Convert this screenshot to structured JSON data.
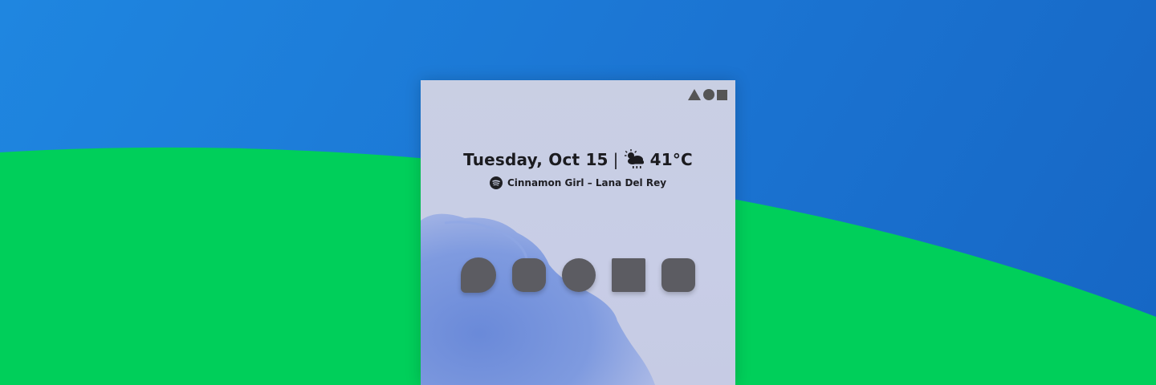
{
  "colors": {
    "background_blue": "#1b74d2",
    "hill_green": "#00cf5a",
    "phone_bg": "#c9cfe3",
    "icon_gray": "#5c5c62",
    "splash_blue": "#6b8fdc"
  },
  "status_bar": {
    "icons": [
      "triangle-icon",
      "circle-icon",
      "square-icon"
    ]
  },
  "glance": {
    "date": "Tuesday, Oct 15",
    "separator": "|",
    "weather_icon": "cloud-rain-sun-icon",
    "temperature": "41°C"
  },
  "now_playing": {
    "icon": "spotify-icon",
    "text": "Cinnamon Girl – Lana Del Rey"
  },
  "home_icons": [
    {
      "shape": "teardrop",
      "icon": "teardrop-app-icon"
    },
    {
      "shape": "squircle",
      "icon": "squircle-app-icon"
    },
    {
      "shape": "circle",
      "icon": "circle-app-icon"
    },
    {
      "shape": "square",
      "icon": "square-app-icon"
    },
    {
      "shape": "rounded-square",
      "icon": "rounded-square-app-icon"
    }
  ]
}
